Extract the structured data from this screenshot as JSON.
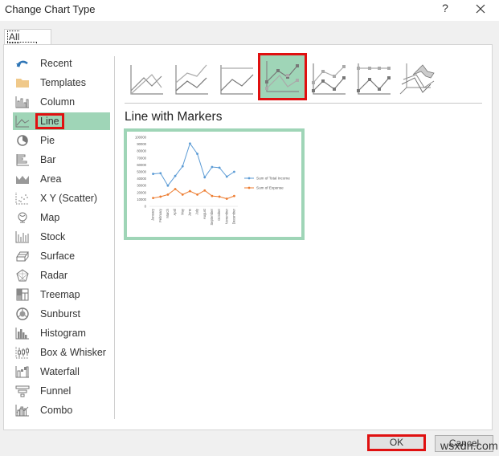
{
  "window": {
    "title": "Change Chart Type",
    "help_label": "?",
    "close_icon": "close-icon"
  },
  "tabs": [
    {
      "label": "All Charts",
      "active": true
    }
  ],
  "sidebar": {
    "items": [
      {
        "label": "Recent",
        "icon": "recent-icon"
      },
      {
        "label": "Templates",
        "icon": "folder-icon"
      },
      {
        "label": "Column",
        "icon": "column-chart-icon"
      },
      {
        "label": "Line",
        "icon": "line-chart-icon",
        "selected": true
      },
      {
        "label": "Pie",
        "icon": "pie-chart-icon"
      },
      {
        "label": "Bar",
        "icon": "bar-chart-icon"
      },
      {
        "label": "Area",
        "icon": "area-chart-icon"
      },
      {
        "label": "X Y (Scatter)",
        "icon": "scatter-chart-icon"
      },
      {
        "label": "Map",
        "icon": "map-globe-icon"
      },
      {
        "label": "Stock",
        "icon": "stock-chart-icon"
      },
      {
        "label": "Surface",
        "icon": "surface-chart-icon"
      },
      {
        "label": "Radar",
        "icon": "radar-chart-icon"
      },
      {
        "label": "Treemap",
        "icon": "treemap-icon"
      },
      {
        "label": "Sunburst",
        "icon": "sunburst-icon"
      },
      {
        "label": "Histogram",
        "icon": "histogram-icon"
      },
      {
        "label": "Box & Whisker",
        "icon": "box-whisker-icon"
      },
      {
        "label": "Waterfall",
        "icon": "waterfall-icon"
      },
      {
        "label": "Funnel",
        "icon": "funnel-icon"
      },
      {
        "label": "Combo",
        "icon": "combo-chart-icon"
      }
    ]
  },
  "subtypes": {
    "items": [
      {
        "name": "line",
        "icon": "line-subtype-icon"
      },
      {
        "name": "stacked-line",
        "icon": "stacked-line-subtype-icon"
      },
      {
        "name": "100-stacked-line",
        "icon": "100-stacked-line-subtype-icon"
      },
      {
        "name": "line-with-markers",
        "icon": "line-markers-subtype-icon",
        "selected": true
      },
      {
        "name": "stacked-line-with-markers",
        "icon": "stacked-line-markers-subtype-icon"
      },
      {
        "name": "100-stacked-line-with-markers",
        "icon": "100-stacked-line-markers-subtype-icon"
      },
      {
        "name": "3d-line",
        "icon": "3d-line-subtype-icon"
      }
    ],
    "selected_title": "Line with Markers"
  },
  "colors": {
    "selection": "#9fd5b7",
    "highlight_box": "#e01010",
    "series_income": "#5b9bd5",
    "series_expense": "#ed7d31"
  },
  "chart_data": {
    "type": "line",
    "categories": [
      "January",
      "February",
      "March",
      "April",
      "May",
      "June",
      "July",
      "August",
      "September",
      "October",
      "November",
      "December"
    ],
    "series": [
      {
        "name": "Sum of Total Income",
        "values": [
          47000,
          48000,
          30000,
          44000,
          58000,
          91000,
          76000,
          42000,
          57000,
          56000,
          43000,
          50000
        ]
      },
      {
        "name": "Sum of Expense",
        "values": [
          12000,
          14000,
          17000,
          25000,
          17000,
          22000,
          17000,
          23000,
          15000,
          14000,
          11000,
          15000
        ]
      }
    ],
    "yticks": [
      "0",
      "10000",
      "20000",
      "30000",
      "40000",
      "50000",
      "60000",
      "70000",
      "80000",
      "90000",
      "100000"
    ],
    "ylim": [
      0,
      100000
    ],
    "title": "",
    "xlabel": "",
    "ylabel": "",
    "legend": "right",
    "grid": false,
    "markers": true
  },
  "footer": {
    "ok_label": "OK",
    "cancel_label": "Cancel",
    "watermark": "wsxdn.com"
  }
}
